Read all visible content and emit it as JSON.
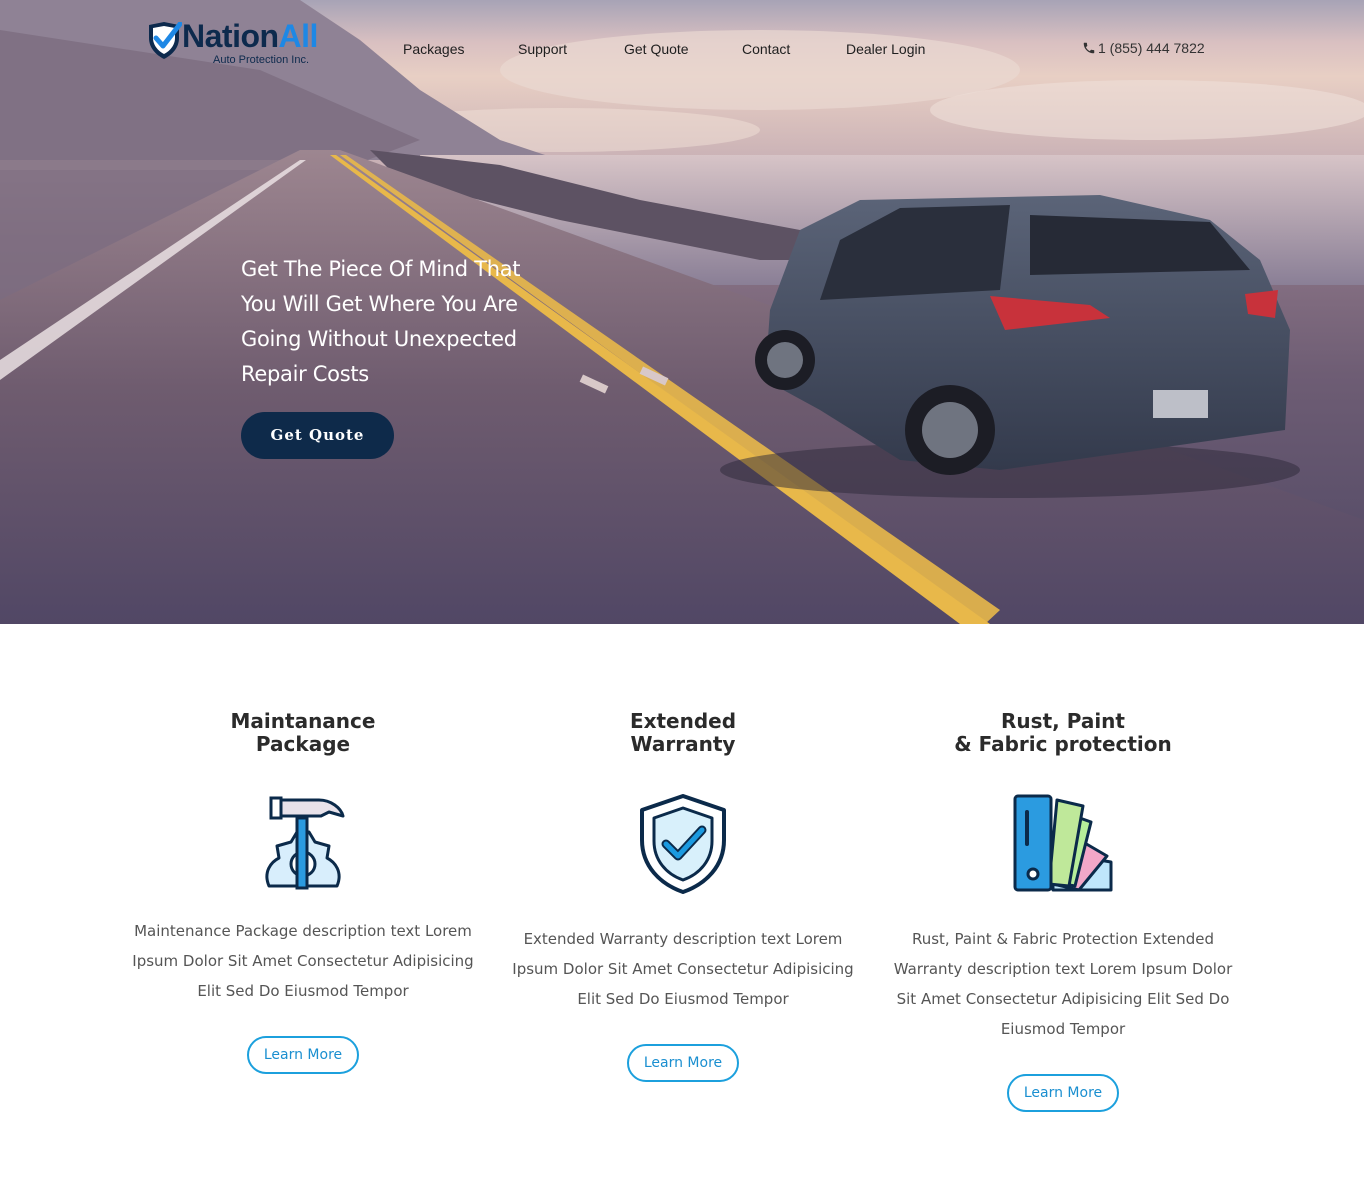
{
  "brand": {
    "name_part1": "Nation",
    "name_part2": "All",
    "tagline": "Auto Protection Inc."
  },
  "nav": {
    "items": [
      {
        "label": "Packages"
      },
      {
        "label": "Support"
      },
      {
        "label": "Get Quote"
      },
      {
        "label": "Contact"
      },
      {
        "label": "Dealer Login"
      }
    ],
    "phone": "1 (855) 444 7822"
  },
  "hero": {
    "headline": "Get The Piece Of Mind That You Will Get Where You Are Going Without Unexpected Repair Costs",
    "cta_label": "Get Quote"
  },
  "features": [
    {
      "title_line1": "Maintanance",
      "title_line2": "Package",
      "icon": "hammer-gear-icon",
      "description": "Maintenance Package description text Lorem Ipsum Dolor Sit Amet Consectetur Adipisicing Elit Sed Do Eiusmod Tempor",
      "button_label": "Learn More"
    },
    {
      "title_line1": "Extended",
      "title_line2": "Warranty",
      "icon": "shield-check-icon",
      "description": "Extended Warranty description text Lorem Ipsum Dolor Sit Amet Consectetur Adipisicing Elit Sed Do Eiusmod Tempor",
      "button_label": "Learn More"
    },
    {
      "title_line1": "Rust, Paint",
      "title_line2": "& Fabric protection",
      "icon": "color-swatch-icon",
      "description": "Rust, Paint & Fabric Protection Extended Warranty description text Lorem Ipsum Dolor Sit Amet Consectetur Adipisicing Elit Sed Do Eiusmod Tempor",
      "button_label": "Learn More"
    }
  ],
  "colors": {
    "brand_navy": "#0e2a4a",
    "brand_blue": "#1e88e5",
    "button_outline": "#1ca0dd"
  }
}
